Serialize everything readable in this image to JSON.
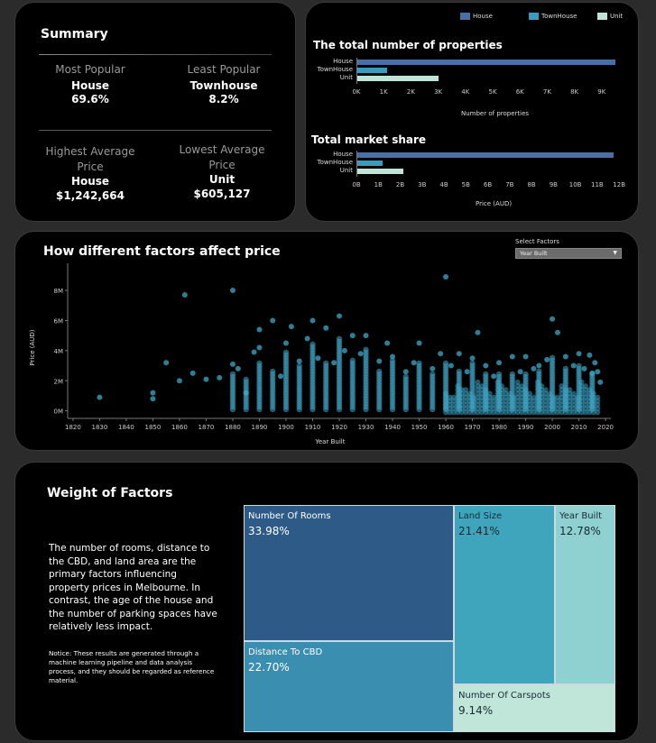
{
  "summary": {
    "title": "Summary",
    "most_popular_label": "Most Popular",
    "most_popular_type": "House",
    "most_popular_value": "69.6%",
    "least_popular_label": "Least Popular",
    "least_popular_type": "Townhouse",
    "least_popular_value": "8.2%",
    "highest_label_1": "Highest Average",
    "highest_label_2": "Price",
    "highest_type": "House",
    "highest_value": "$1,242,664",
    "lowest_label_1": "Lowest Average",
    "lowest_label_2": "Price",
    "lowest_type": "Unit",
    "lowest_value": "$605,127"
  },
  "legend": [
    {
      "label": "House",
      "color": "#4a6fa5"
    },
    {
      "label": "TownHouse",
      "color": "#3a9bbf"
    },
    {
      "label": "Unit",
      "color": "#bfe3d6"
    }
  ],
  "count_chart": {
    "title": "The total number of properties",
    "xlabel": "Number of properties",
    "categories": [
      "House",
      "TownHouse",
      "Unit"
    ],
    "values": [
      9500,
      1120,
      3020
    ],
    "ticks": [
      "0K",
      "1K",
      "2K",
      "3K",
      "4K",
      "5K",
      "6K",
      "7K",
      "8K",
      "9K"
    ],
    "xlim": [
      0,
      9800
    ]
  },
  "share_chart": {
    "title": "Total market share",
    "xlabel": "Price (AUD)",
    "categories": [
      "House",
      "TownHouse",
      "Unit"
    ],
    "values": [
      11.75,
      1.2,
      2.15
    ],
    "ticks": [
      "0B",
      "1B",
      "2B",
      "3B",
      "4B",
      "5B",
      "6B",
      "7B",
      "8B",
      "9B",
      "10B",
      "11B",
      "12B"
    ],
    "xlim": [
      0,
      12.2
    ]
  },
  "factors": {
    "title": "How different factors affect price",
    "select_label": "Select Factors",
    "select_value": "Year Built",
    "xlabel": "Year Built",
    "ylabel": "Price (AUD)",
    "xticks": [
      "1820",
      "1830",
      "1840",
      "1850",
      "1860",
      "1870",
      "1880",
      "1890",
      "1900",
      "1910",
      "1920",
      "1930",
      "1940",
      "1950",
      "1960",
      "1970",
      "1980",
      "1990",
      "2000",
      "2010",
      "2020"
    ],
    "yticks": [
      "0M",
      "2M",
      "4M",
      "6M",
      "8M"
    ]
  },
  "chart_data": {
    "type": "scatter",
    "title": "How different factors affect price",
    "xlabel": "Year Built",
    "ylabel": "Price (AUD)",
    "xlim": [
      1818,
      2022
    ],
    "ylim": [
      -0.5,
      9.5
    ],
    "y_unit": "M",
    "points": [
      [
        1830,
        0.9
      ],
      [
        1850,
        0.8
      ],
      [
        1850,
        1.2
      ],
      [
        1855,
        3.2
      ],
      [
        1860,
        2.0
      ],
      [
        1862,
        7.7
      ],
      [
        1865,
        2.5
      ],
      [
        1870,
        2.1
      ],
      [
        1875,
        2.2
      ],
      [
        1880,
        8.0
      ],
      [
        1880,
        3.1
      ],
      [
        1882,
        2.8
      ],
      [
        1885,
        1.2
      ],
      [
        1888,
        3.9
      ],
      [
        1890,
        4.2
      ],
      [
        1890,
        5.4
      ],
      [
        1895,
        6.0
      ],
      [
        1898,
        2.3
      ],
      [
        1900,
        4.5
      ],
      [
        1902,
        5.6
      ],
      [
        1905,
        3.3
      ],
      [
        1908,
        4.8
      ],
      [
        1910,
        6.0
      ],
      [
        1912,
        3.5
      ],
      [
        1915,
        5.5
      ],
      [
        1918,
        3.2
      ],
      [
        1920,
        6.3
      ],
      [
        1922,
        4.0
      ],
      [
        1925,
        5.0
      ],
      [
        1928,
        3.8
      ],
      [
        1930,
        5.0
      ],
      [
        1935,
        3.3
      ],
      [
        1938,
        4.5
      ],
      [
        1940,
        3.6
      ],
      [
        1945,
        2.6
      ],
      [
        1948,
        3.2
      ],
      [
        1950,
        4.5
      ],
      [
        1955,
        2.8
      ],
      [
        1958,
        3.8
      ],
      [
        1960,
        8.9
      ],
      [
        1962,
        3.0
      ],
      [
        1965,
        3.8
      ],
      [
        1968,
        2.6
      ],
      [
        1970,
        3.5
      ],
      [
        1972,
        5.2
      ],
      [
        1975,
        3.0
      ],
      [
        1978,
        2.3
      ],
      [
        1980,
        3.2
      ],
      [
        1985,
        3.6
      ],
      [
        1988,
        2.6
      ],
      [
        1990,
        3.6
      ],
      [
        1993,
        2.8
      ],
      [
        1995,
        3.0
      ],
      [
        1998,
        3.4
      ],
      [
        2000,
        6.1
      ],
      [
        2002,
        5.2
      ],
      [
        2005,
        3.6
      ],
      [
        2008,
        3.0
      ],
      [
        2010,
        3.8
      ],
      [
        2012,
        2.8
      ],
      [
        2014,
        3.7
      ],
      [
        2015,
        2.5
      ],
      [
        2016,
        3.2
      ],
      [
        2017,
        2.6
      ],
      [
        2018,
        1.9
      ]
    ],
    "dense_bands": [
      {
        "year": 1880,
        "max": 2.6
      },
      {
        "year": 1885,
        "max": 2.2
      },
      {
        "year": 1890,
        "max": 3.2
      },
      {
        "year": 1895,
        "max": 2.8
      },
      {
        "year": 1900,
        "max": 4.0
      },
      {
        "year": 1905,
        "max": 3.0
      },
      {
        "year": 1910,
        "max": 4.6
      },
      {
        "year": 1915,
        "max": 3.2
      },
      {
        "year": 1920,
        "max": 4.8
      },
      {
        "year": 1925,
        "max": 3.5
      },
      {
        "year": 1930,
        "max": 4.2
      },
      {
        "year": 1935,
        "max": 2.8
      },
      {
        "year": 1940,
        "max": 3.5
      },
      {
        "year": 1945,
        "max": 2.4
      },
      {
        "year": 1950,
        "max": 3.2
      },
      {
        "year": 1955,
        "max": 2.6
      },
      {
        "year": 1960,
        "max": 3.3
      },
      {
        "year": 1965,
        "max": 2.8
      },
      {
        "year": 1970,
        "max": 3.3
      },
      {
        "year": 1975,
        "max": 2.6
      },
      {
        "year": 1980,
        "max": 2.6
      },
      {
        "year": 1985,
        "max": 2.5
      },
      {
        "year": 1990,
        "max": 2.6
      },
      {
        "year": 1995,
        "max": 2.8
      },
      {
        "year": 2000,
        "max": 3.6
      },
      {
        "year": 2005,
        "max": 2.9
      },
      {
        "year": 2010,
        "max": 3.1
      },
      {
        "year": 2015,
        "max": 2.5
      }
    ],
    "color": "#3fa8c8"
  },
  "weights": {
    "title": "Weight of Factors",
    "description": "The number of rooms, distance to the CBD, and land area are the primary factors influencing property prices in Melbourne. In contrast, the age of the house and the number of parking spaces have relatively less impact.",
    "notice": "Notice: These results are generated through a machine learning pipeline and data analysis process, and they should be regarded as reference material.",
    "tiles": [
      {
        "name": "Number Of Rooms",
        "value": "33.98%",
        "color": "#2d5a87",
        "text": "#ffffff"
      },
      {
        "name": "Distance To CBD",
        "value": "22.70%",
        "color": "#3a8fb0",
        "text": "#ffffff"
      },
      {
        "name": "Land Size",
        "value": "21.41%",
        "color": "#3fa5bd",
        "text": "#1a2a33"
      },
      {
        "name": "Year Built",
        "value": "12.78%",
        "color": "#8fd0d0",
        "text": "#1a2a33"
      },
      {
        "name": "Number Of Carspots",
        "value": "9.14%",
        "color": "#bfe6d8",
        "text": "#1a2a33"
      }
    ]
  }
}
